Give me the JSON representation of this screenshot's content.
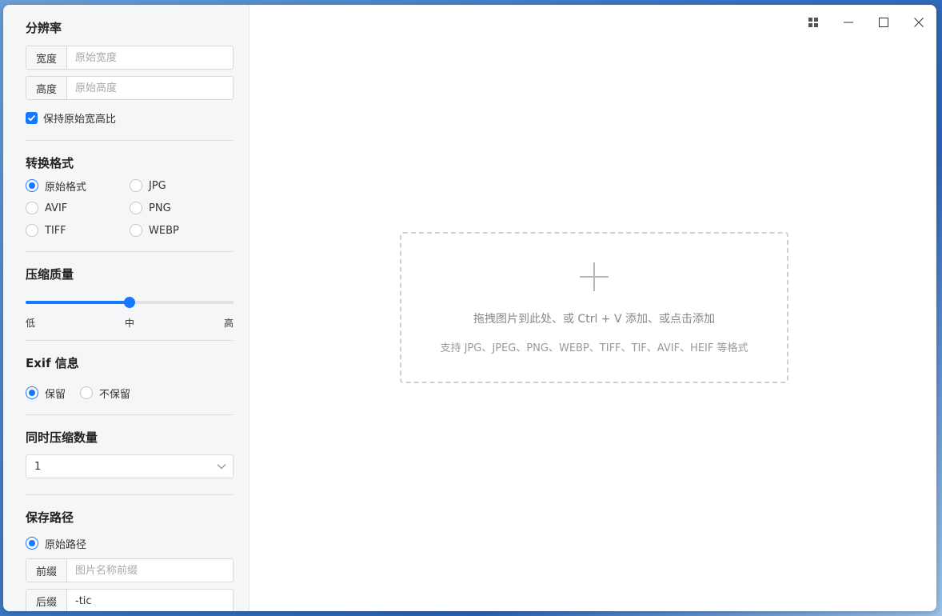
{
  "window": {
    "controls": {
      "layout_icon": "grid-icon",
      "minimize_icon": "minimize-icon",
      "maximize_icon": "maximize-icon",
      "close_icon": "close-icon"
    }
  },
  "sidebar": {
    "resolution": {
      "title": "分辨率",
      "width_label": "宽度",
      "width_placeholder": "原始宽度",
      "height_label": "高度",
      "height_placeholder": "原始高度",
      "keep_ratio_label": "保持原始宽高比",
      "keep_ratio_checked": true
    },
    "format": {
      "title": "转换格式",
      "options": [
        "原始格式",
        "JPG",
        "AVIF",
        "PNG",
        "TIFF",
        "WEBP"
      ],
      "selected": "原始格式"
    },
    "quality": {
      "title": "压缩质量",
      "level": 0.5,
      "labels": {
        "low": "低",
        "mid": "中",
        "high": "高"
      }
    },
    "exif": {
      "title": "Exif 信息",
      "options": [
        "保留",
        "不保留"
      ],
      "selected": "保留"
    },
    "concurrency": {
      "title": "同时压缩数量",
      "value": "1"
    },
    "save_path": {
      "title": "保存路径",
      "option_label": "原始路径",
      "prefix_label": "前缀",
      "prefix_placeholder": "图片名称前缀",
      "suffix_label": "后缀",
      "suffix_value": "-tic"
    }
  },
  "dropzone": {
    "main_text": "拖拽图片到此处、或 Ctrl + V 添加、或点击添加",
    "formats_text": "支持 JPG、JPEG、PNG、WEBP、TIFF、TIF、AVIF、HEIF 等格式"
  },
  "colors": {
    "accent": "#1677ff",
    "sidebar_bg": "#f5f6f8"
  }
}
